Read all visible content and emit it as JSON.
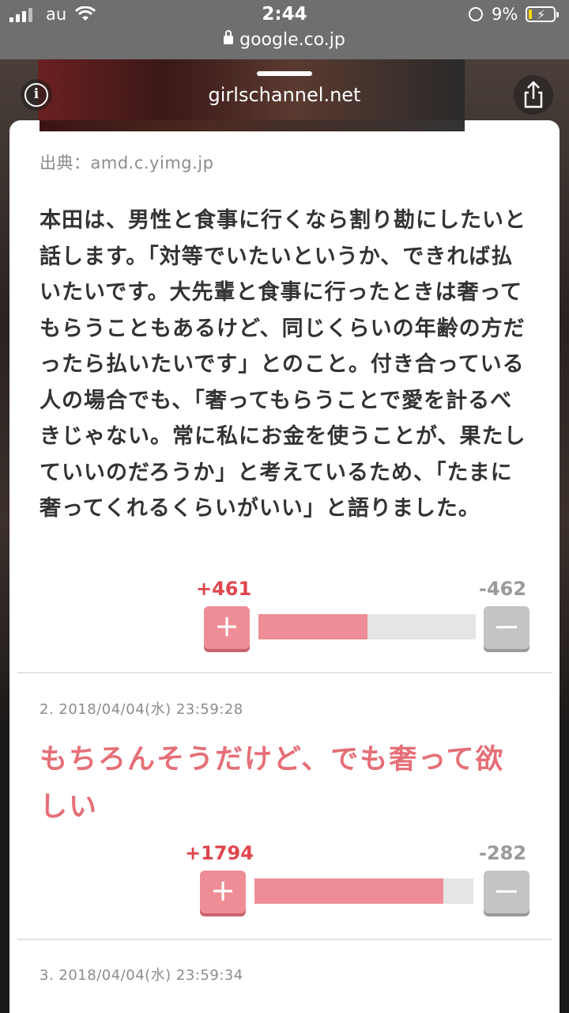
{
  "status_bar": {
    "carrier": "au",
    "time": "2:44",
    "url": "google.co.jp",
    "battery_percent": "9%"
  },
  "sheet_header": {
    "site": "girlschannel.net"
  },
  "article": {
    "source": "出典：amd.c.yimg.jp",
    "body": "本田は、男性と食事に行くなら割り勘にしたいと話します。「対等でいたいというか、できれば払いたいです。大先輩と食事に行ったときは奢ってもらうこともあるけど、同じくらいの年齢の方だったら払いたいです」とのこと。付き合っている人の場合でも、「奢ってもらうことで愛を計るべきじゃない。常に私にお金を使うことが、果たしていいのだろうか」と考えているため、「たまに奢ってくれるくらいがいい」と語りました。",
    "votes": {
      "plus": "+461",
      "minus": "-462",
      "plus_ratio": 0.5
    }
  },
  "comments": [
    {
      "meta": "2. 2018/04/04(水) 23:59:28",
      "text": "もちろんそうだけど、でも奢って欲しい",
      "votes": {
        "plus": "+1794",
        "minus": "-282",
        "plus_ratio": 0.864
      }
    },
    {
      "meta": "3. 2018/04/04(水) 23:59:34"
    }
  ],
  "colors": {
    "accent": "#e56f77",
    "plus": "#ee8d95",
    "plus_text": "#e0464e",
    "minus": "#c4c4c4"
  }
}
